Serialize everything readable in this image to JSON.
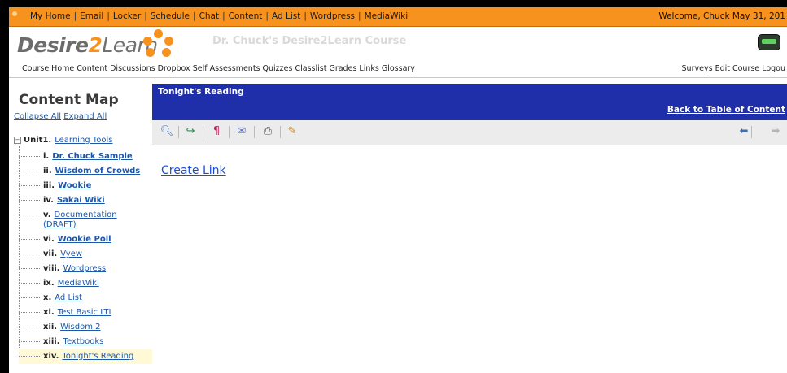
{
  "topbar": {
    "links": [
      "My Home",
      "Email",
      "Locker",
      "Schedule",
      "Chat",
      "Content",
      "Ad List",
      "Wordpress",
      "MediaWiki"
    ],
    "separator": "|",
    "welcome": "Welcome, Chuck May 31, 201"
  },
  "header": {
    "logo_part1": "Desire",
    "logo_part2": "2",
    "logo_part3": "Learn",
    "course_title": "Dr. Chuck's Desire2Learn Course",
    "nav": [
      "Course Home",
      "Content",
      "Discussions",
      "Dropbox",
      "Self Assessments",
      "Quizzes",
      "Classlist",
      "Grades",
      "Links",
      "Glossary"
    ],
    "nav_right": [
      "Surveys",
      "Edit Course",
      "Logou"
    ]
  },
  "sidebar": {
    "title": "Content Map",
    "collapse_all": "Collapse All",
    "expand_all": "Expand All",
    "tree_toggle": "−",
    "unit_label": "Unit1.",
    "unit_title": "Learning Tools",
    "items": [
      {
        "num": "i.",
        "title": "Dr. Chuck Sample"
      },
      {
        "num": "ii.",
        "title": "Wisdom of Crowds"
      },
      {
        "num": "iii.",
        "title": "Wookie"
      },
      {
        "num": "iv.",
        "title": "Sakai Wiki"
      },
      {
        "num": "v.",
        "title": "Documentation (DRAFT)"
      },
      {
        "num": "vi.",
        "title": "Wookie Poll"
      },
      {
        "num": "vii.",
        "title": "Vyew"
      },
      {
        "num": "viii.",
        "title": "Wordpress"
      },
      {
        "num": "ix.",
        "title": "MediaWiki"
      },
      {
        "num": "x.",
        "title": "Ad List"
      },
      {
        "num": "xi.",
        "title": "Test Basic LTI"
      },
      {
        "num": "xii.",
        "title": "Wisdom 2"
      },
      {
        "num": "xiii.",
        "title": "Textbooks"
      },
      {
        "num": "xiv.",
        "title": "Tonight's Reading"
      }
    ]
  },
  "content": {
    "title": "Tonight's Reading",
    "back_link": "Back to Table of Content",
    "create_link": "Create Link"
  },
  "colors": {
    "topbar": "#f7921e",
    "content_header": "#1e2fa9",
    "link": "#1f57a6"
  }
}
